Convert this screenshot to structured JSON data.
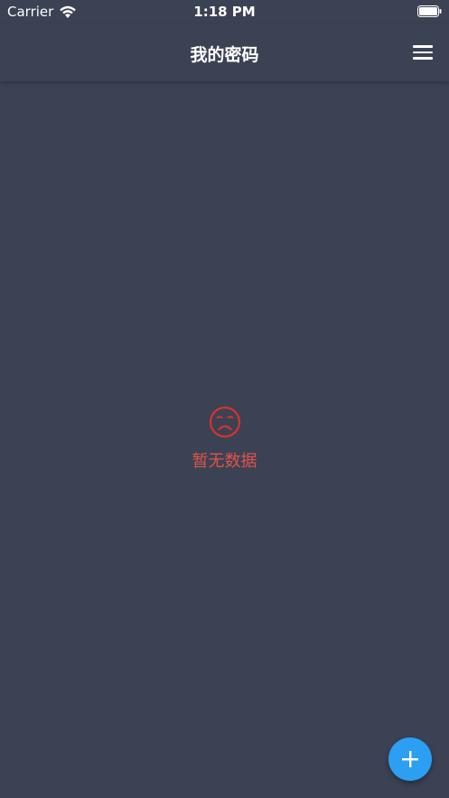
{
  "status_bar": {
    "carrier": "Carrier",
    "time": "1:18 PM"
  },
  "nav": {
    "title": "我的密码",
    "menu_icon": "menu-icon"
  },
  "empty_state": {
    "icon": "sad-face-icon",
    "message": "暂无数据",
    "color": "#e0534a"
  },
  "fab": {
    "icon": "plus-icon",
    "color": "#2c9ff2"
  },
  "colors": {
    "background": "#3b4254",
    "text": "#ffffff"
  }
}
